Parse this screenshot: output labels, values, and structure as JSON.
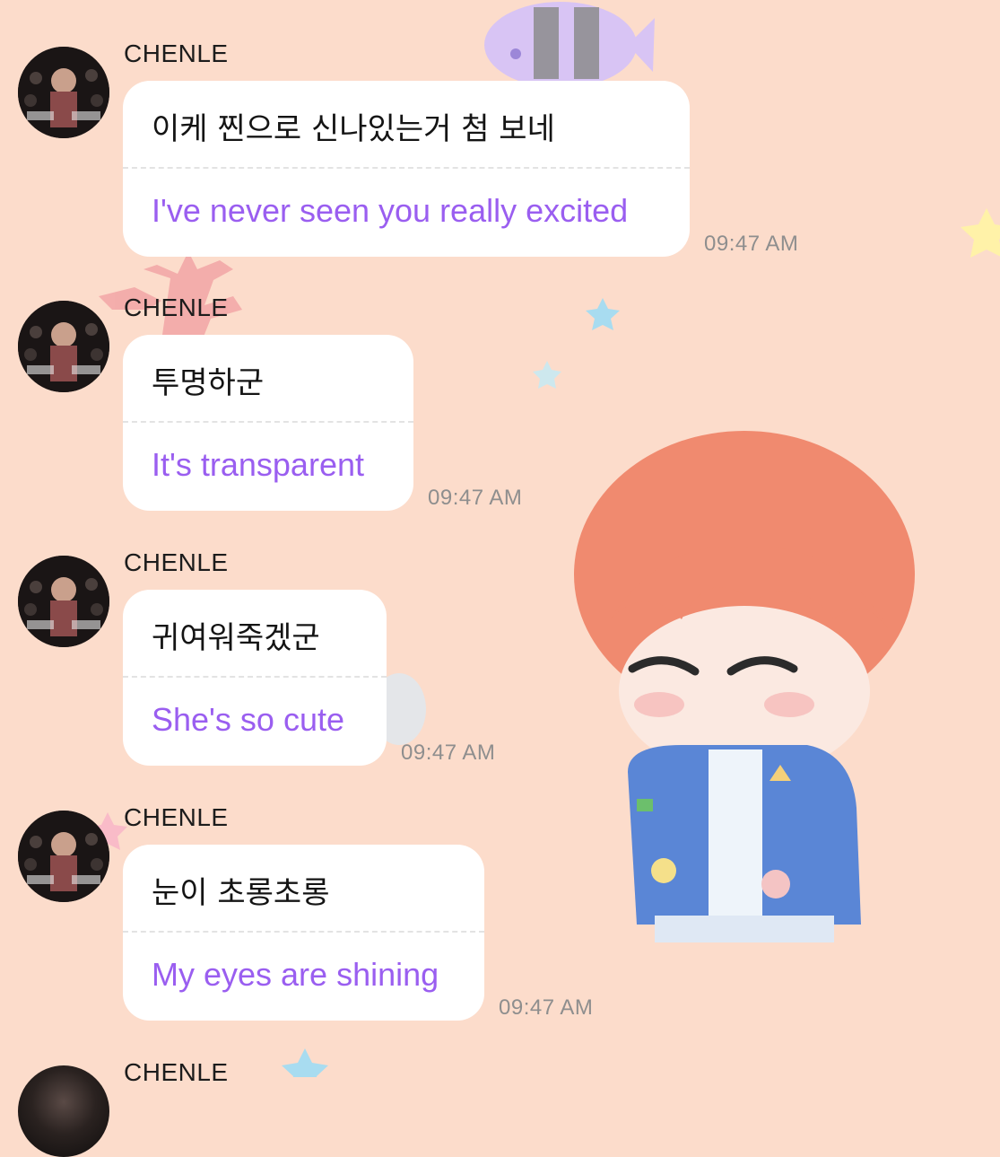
{
  "messages": [
    {
      "sender": "CHENLE",
      "original": "이케 찐으로 신나있는거 첨 보네",
      "translation": "I've never seen you really excited",
      "time": "09:47 AM"
    },
    {
      "sender": "CHENLE",
      "original": "투명하군",
      "translation": "It's transparent",
      "time": "09:47 AM"
    },
    {
      "sender": "CHENLE",
      "original": "귀여워죽겠군",
      "translation": "She's so cute",
      "time": "09:47 AM"
    },
    {
      "sender": "CHENLE",
      "original": "눈이 초롱초롱",
      "translation": "My eyes are shining",
      "time": "09:47 AM"
    },
    {
      "sender": "CHENLE"
    }
  ],
  "colors": {
    "background": "#fcdccb",
    "bubble": "#ffffff",
    "translation_text": "#9a5ef0",
    "timestamp": "#8e8e8e",
    "sender": "#1c1c1c"
  }
}
